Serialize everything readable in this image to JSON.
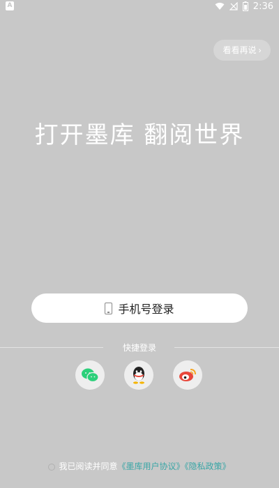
{
  "status_bar": {
    "left_badge": "A",
    "time": "2:36"
  },
  "skip_button": {
    "label": "看看再说",
    "chevron": "›"
  },
  "slogan": "打开墨库 翻阅世界",
  "phone_login": {
    "label": "手机号登录",
    "icon": "phone-icon"
  },
  "quick_login": {
    "label": "快捷登录",
    "options": [
      {
        "icon": "wechat-icon"
      },
      {
        "icon": "qq-icon"
      },
      {
        "icon": "weibo-icon"
      }
    ]
  },
  "agreement": {
    "prefix": "我已阅读并同意",
    "user_agreement": "《墨库用户协议》",
    "privacy_policy": "《隐私政策》"
  },
  "colors": {
    "background": "#c8c8c8",
    "link": "#3aa6a6",
    "wechat": "#2bd07a",
    "weibo": "#e8473b"
  }
}
